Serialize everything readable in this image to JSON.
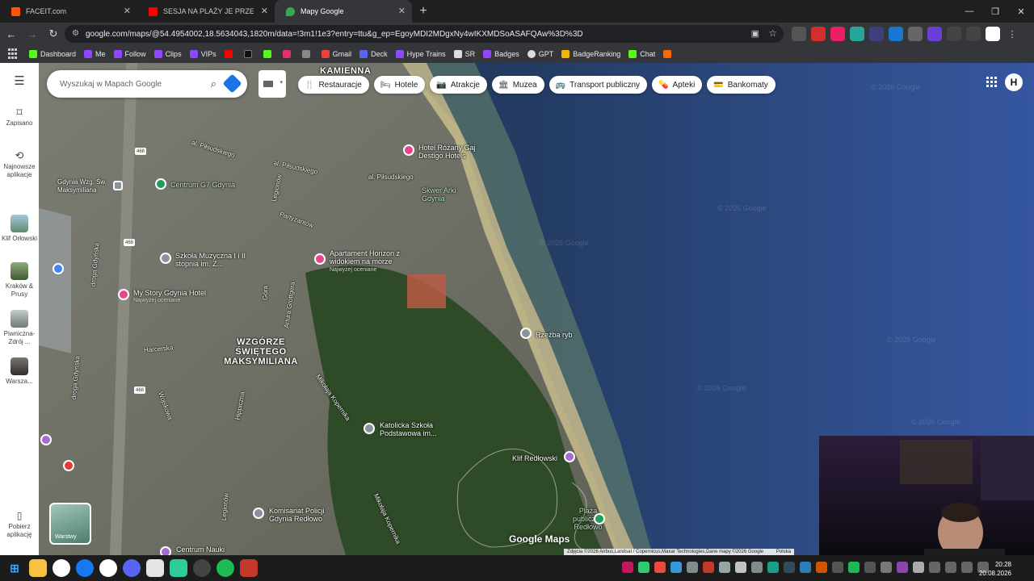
{
  "browser": {
    "tabs": [
      {
        "label": "FACEIT.com",
        "color": "#ff5500"
      },
      {
        "label": "SESJA NA PLAŻY JE PRZEROSŁA",
        "color": "#ff0000"
      },
      {
        "label": "Mapy Google",
        "color": "#34a853"
      }
    ],
    "new_tab": "+",
    "url": "google.com/maps/@54.4954002,18.5634043,1820m/data=!3m1!1e3?entry=ttu&g_ep=EgoyMDI2MDgxNy4wIKXMDSoASAFQAw%3D%3D",
    "bookmarks": [
      {
        "label": "Dashboard",
        "color": "#53fc18"
      },
      {
        "label": "Me",
        "color": "#9146ff"
      },
      {
        "label": "Follow",
        "color": "#9146ff"
      },
      {
        "label": "Clips",
        "color": "#9146ff"
      },
      {
        "label": "VIPs",
        "color": "#9146ff"
      },
      {
        "label": "",
        "color": "#ff0000"
      },
      {
        "label": "",
        "color": "#000000"
      },
      {
        "label": "",
        "color": "#53fc18"
      },
      {
        "label": "",
        "color": "#e1306c"
      },
      {
        "label": "",
        "color": "#888888"
      },
      {
        "label": "Gmail",
        "color": "#ea4335"
      },
      {
        "label": "Deck",
        "color": "#5865f2"
      },
      {
        "label": "Hype Trains",
        "color": "#9146ff"
      },
      {
        "label": "SR",
        "color": "#dddddd"
      },
      {
        "label": "Badges",
        "color": "#9146ff"
      },
      {
        "label": "GPT",
        "color": "#dddddd"
      },
      {
        "label": "BadgeRanking",
        "color": "#f4b400"
      },
      {
        "label": "Chat",
        "color": "#53fc18"
      },
      {
        "label": "",
        "color": "#ff6600"
      }
    ]
  },
  "maps": {
    "search_placeholder": "Wyszukaj w Mapach Google",
    "rail": [
      {
        "label": "Zapisano",
        "icon": "bookmark-icon"
      },
      {
        "label": "Najnowsze aplikacje",
        "icon": "history-icon"
      },
      {
        "label": "Klif Orłowski",
        "thumb": "#7ea8c9"
      },
      {
        "label": "Kraków & Prusy",
        "thumb": "#6f8c5e"
      },
      {
        "label": "Piwniczna-Zdrój ...",
        "thumb": "#9aa5a0"
      },
      {
        "label": "Warsza...",
        "thumb": "#5c5a55"
      },
      {
        "label": "Pobierz aplikację",
        "icon": "phone-icon"
      }
    ],
    "chips": [
      {
        "label": "Restauracje",
        "icon": "🍴"
      },
      {
        "label": "Hotele",
        "icon": "🛏"
      },
      {
        "label": "Atrakcje",
        "icon": "📷"
      },
      {
        "label": "Muzea",
        "icon": "🏛"
      },
      {
        "label": "Transport publiczny",
        "icon": "🚌"
      },
      {
        "label": "Apteki",
        "icon": "💊"
      },
      {
        "label": "Bankomaty",
        "icon": "💳"
      }
    ],
    "account_initial": "H",
    "layers_label": "Warstwy",
    "logo": "Google Maps",
    "attribution": "Zdjęcia ©2026 Airbus,Landsat / Copernicus,Maxar Technologies,Dane mapy ©2026 Google",
    "attribution_extra": "Polska",
    "labels": {
      "kamienna": "KAMIENNA",
      "wzgorze": "WZGÓRZE ŚWIĘTEGO MAKSYMILIANA",
      "hotel_rozany": "Hotel Różany Gaj Destigo Hotels",
      "skwer": "Skwer Arki Gdynia",
      "centrum_gw": "Centrum G7 Gdynia",
      "gdynia_wzg": "Gdynia Wzg. Św. Maksymiliana",
      "szkola_muz": "Szkoła Muzyczna I i II stopnia im. Z...",
      "apartament": "Apartament Horizon z widokiem na morze",
      "apartament_sub": "Najwyżej oceniane",
      "mystory": "My Story Gdynia Hotel",
      "mystory_sub": "Najwyżej oceniane",
      "rzezba": "Rzeźba ryb",
      "katolicka": "Katolicka Szkoła Podstawowa im...",
      "klif": "Klif Redłowski",
      "plaza": "Plaża publiczna Redłowo",
      "komisariat": "Komisariat Policji Gdynia Redłowo",
      "centrum_nauki": "Centrum Nauki",
      "piludskiego1": "al. Piłsudskiego",
      "piludskiego2": "al. Piłsudskiego",
      "piludskiego3": "al. Piłsudskiego",
      "legionow": "Legionów",
      "partyzantow": "Partyzantów",
      "droga_gdynska": "droga Gdyńska",
      "harcerska": "Harcerska",
      "wojskowa": "Wojskowa",
      "kopernika": "Mikołaja Kopernika",
      "gora": "Góra",
      "grottgera": "Artura Grottgera",
      "hippiczna": "Hippiczna",
      "road468": "468"
    },
    "watermark": "© 2026 Google"
  },
  "taskbar": {
    "time": "20:28",
    "date": "20.08.2026"
  }
}
